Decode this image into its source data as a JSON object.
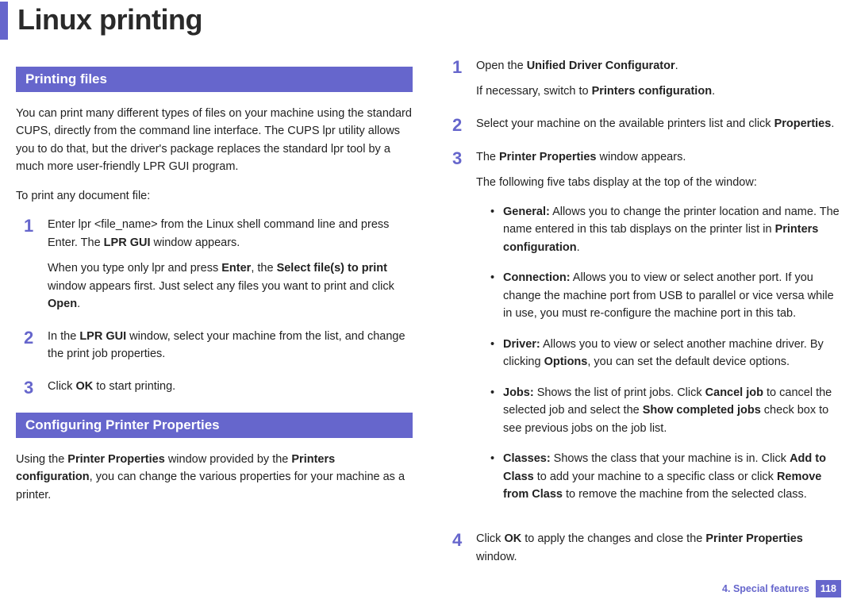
{
  "title": "Linux printing",
  "left": {
    "section1_title": "Printing files",
    "intro1": "You can print many different types of files on your machine using the standard CUPS, directly from the command line interface. The CUPS lpr utility allows you to do that, but the driver's package replaces the standard lpr tool by a much more user-friendly LPR GUI program.",
    "intro2": "To print any document file:",
    "steps": [
      {
        "num": "1",
        "p1_pre": "Enter lpr <file_name> from the Linux shell command line and press Enter. The ",
        "p1_b1": "LPR GUI",
        "p1_post": " window appears.",
        "p2_a": "When you type only lpr and press ",
        "p2_b1": "Enter",
        "p2_b": ", the ",
        "p2_b2": "Select file(s) to print",
        "p2_c": " window appears first. Just select any files you want to print and click ",
        "p2_b3": "Open",
        "p2_d": "."
      },
      {
        "num": "2",
        "p1_a": "In the ",
        "p1_b1": "LPR GUI",
        "p1_b": " window, select your machine from the list, and change the print job properties."
      },
      {
        "num": "3",
        "p1_a": "Click ",
        "p1_b1": "OK",
        "p1_b": " to start printing."
      }
    ],
    "section2_title": "Configuring Printer Properties",
    "outro_a": "Using the ",
    "outro_b1": "Printer Properties",
    "outro_b": " window provided by the ",
    "outro_b2": "Printers configuration",
    "outro_c": ", you can change the various properties for your machine as a printer."
  },
  "right": {
    "steps": [
      {
        "num": "1",
        "p1_a": "Open the ",
        "p1_b1": "Unified Driver Configurator",
        "p1_b": ".",
        "p2_a": "If necessary, switch to ",
        "p2_b1": "Printers configuration",
        "p2_b": "."
      },
      {
        "num": "2",
        "p1_a": "Select your machine on the available printers list and click ",
        "p1_b1": "Properties",
        "p1_b": "."
      },
      {
        "num": "3",
        "p1_a": "The ",
        "p1_b1": "Printer Properties",
        "p1_b": " window appears.",
        "p2": "The following five tabs display at the top of the window:",
        "tabs": [
          {
            "t": "General:",
            "a": " Allows you to change the printer location and name. The name entered in this tab displays on the printer list in ",
            "b1": "Printers configuration",
            "b": "."
          },
          {
            "t": "Connection:",
            "a": " Allows you to view or select another port. If you change the machine port from USB to parallel or vice versa while in use, you must re-configure the machine port in this tab."
          },
          {
            "t": "Driver:",
            "a": " Allows you to view or select another machine driver. By clicking ",
            "b1": "Options",
            "b": ", you can set the default device options."
          },
          {
            "t": "Jobs:",
            "a": " Shows the list of print jobs. Click ",
            "b1": "Cancel job",
            "b": " to cancel the selected job and select the ",
            "b2": "Show completed jobs",
            "c": " check box to see previous jobs on the job list."
          },
          {
            "t": "Classes:",
            "a": " Shows the class that your machine is in. Click ",
            "b1": "Add to Class",
            "b": " to add your machine to a specific class or click ",
            "b2": "Remove from Class",
            "c": " to remove the machine from the selected class."
          }
        ]
      },
      {
        "num": "4",
        "p1_a": "Click ",
        "p1_b1": "OK",
        "p1_b": " to apply the changes and close the ",
        "p1_b2": "Printer Properties",
        "p1_c": " window."
      }
    ]
  },
  "footer": {
    "chapter": "4.  Special features",
    "page": "118"
  }
}
